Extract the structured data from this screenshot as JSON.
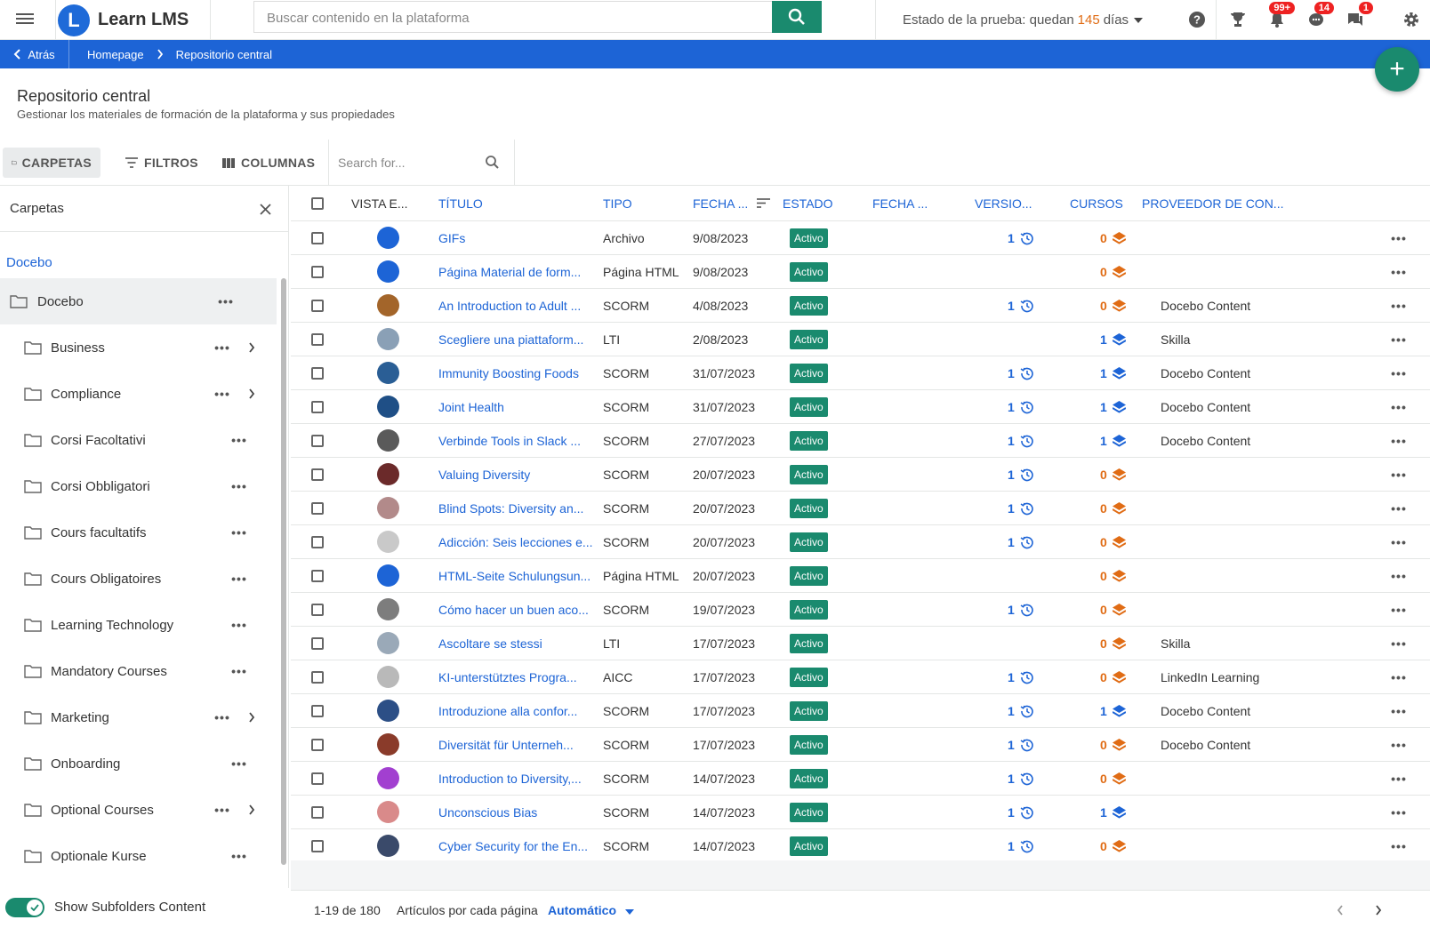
{
  "app": {
    "name": "Learn LMS",
    "logo_letter": "L"
  },
  "header": {
    "search_placeholder": "Buscar contenido en la plataforma",
    "trial_prefix": "Estado de la prueba: quedan",
    "trial_days": "145",
    "trial_suffix": "días",
    "badges": {
      "notifications": "99+",
      "messages": "14",
      "chat": "1"
    }
  },
  "breadcrumb": {
    "back": "Atrás",
    "items": [
      "Homepage",
      "Repositorio central"
    ]
  },
  "page": {
    "title": "Repositorio central",
    "subtitle": "Gestionar los materiales de formación de la plataforma y sus propiedades"
  },
  "toolbar": {
    "folders": "CARPETAS",
    "filters": "FILTROS",
    "columns": "COLUMNAS",
    "search_placeholder": "Search for..."
  },
  "sidebar": {
    "title": "Carpetas",
    "root_link": "Docebo",
    "folders": [
      {
        "label": "Docebo",
        "selected": true,
        "dots": true,
        "chevron": false
      },
      {
        "label": "Business",
        "dots": true,
        "chevron": true
      },
      {
        "label": "Compliance",
        "dots": true,
        "chevron": true
      },
      {
        "label": "Corsi Facoltativi",
        "dots": true,
        "chevron": false
      },
      {
        "label": "Corsi Obbligatori",
        "dots": true,
        "chevron": false
      },
      {
        "label": "Cours facultatifs",
        "dots": true,
        "chevron": false
      },
      {
        "label": "Cours Obligatoires",
        "dots": true,
        "chevron": false
      },
      {
        "label": "Learning Technology",
        "dots": true,
        "chevron": false
      },
      {
        "label": "Mandatory Courses",
        "dots": true,
        "chevron": false
      },
      {
        "label": "Marketing",
        "dots": true,
        "chevron": true
      },
      {
        "label": "Onboarding",
        "dots": true,
        "chevron": false
      },
      {
        "label": "Optional Courses",
        "dots": true,
        "chevron": true
      },
      {
        "label": "Optionale Kurse",
        "dots": true,
        "chevron": false
      }
    ],
    "footer_toggle_label": "Show Subfolders Content",
    "footer_toggle_on": true
  },
  "table": {
    "columns": [
      "VISTA E...",
      "TÍTULO",
      "TIPO",
      "FECHA ...",
      "ESTADO",
      "FECHA ...",
      "VERSIO...",
      "CURSOS",
      "PROVEEDOR DE CON..."
    ],
    "rows": [
      {
        "thumb": "#1d64d6",
        "title": "GIFs",
        "type": "Archivo",
        "date": "9/08/2023",
        "status": "Activo",
        "version": "1",
        "courses": "0",
        "provider": ""
      },
      {
        "thumb": "#1d64d6",
        "title": "Página Material de form...",
        "type": "Página HTML",
        "date": "9/08/2023",
        "status": "Activo",
        "version": "",
        "courses": "0",
        "provider": ""
      },
      {
        "thumb": "#a3652a",
        "title": "An Introduction to Adult ...",
        "type": "SCORM",
        "date": "4/08/2023",
        "status": "Activo",
        "version": "1",
        "courses": "0",
        "provider": "Docebo Content"
      },
      {
        "thumb": "#8aa0b6",
        "title": "Scegliere una piattaform...",
        "type": "LTI",
        "date": "2/08/2023",
        "status": "Activo",
        "version": "",
        "courses": "1",
        "provider": "Skilla"
      },
      {
        "thumb": "#2a5e95",
        "title": "Immunity Boosting Foods",
        "type": "SCORM",
        "date": "31/07/2023",
        "status": "Activo",
        "version": "1",
        "courses": "1",
        "provider": "Docebo Content"
      },
      {
        "thumb": "#1f4f86",
        "title": "Joint Health",
        "type": "SCORM",
        "date": "31/07/2023",
        "status": "Activo",
        "version": "1",
        "courses": "1",
        "provider": "Docebo Content"
      },
      {
        "thumb": "#5a5a5a",
        "title": "Verbinde Tools in Slack ...",
        "type": "SCORM",
        "date": "27/07/2023",
        "status": "Activo",
        "version": "1",
        "courses": "1",
        "provider": "Docebo Content"
      },
      {
        "thumb": "#6b2a2a",
        "title": "Valuing Diversity",
        "type": "SCORM",
        "date": "20/07/2023",
        "status": "Activo",
        "version": "1",
        "courses": "0",
        "provider": ""
      },
      {
        "thumb": "#b28a8a",
        "title": "Blind Spots: Diversity an...",
        "type": "SCORM",
        "date": "20/07/2023",
        "status": "Activo",
        "version": "1",
        "courses": "0",
        "provider": ""
      },
      {
        "thumb": "#c9c9c9",
        "title": "Adicción: Seis lecciones e...",
        "type": "SCORM",
        "date": "20/07/2023",
        "status": "Activo",
        "version": "1",
        "courses": "0",
        "provider": ""
      },
      {
        "thumb": "#1d64d6",
        "title": "HTML-Seite Schulungsun...",
        "type": "Página HTML",
        "date": "20/07/2023",
        "status": "Activo",
        "version": "",
        "courses": "0",
        "provider": ""
      },
      {
        "thumb": "#7d7d7d",
        "title": "Cómo hacer un buen aco...",
        "type": "SCORM",
        "date": "19/07/2023",
        "status": "Activo",
        "version": "1",
        "courses": "0",
        "provider": ""
      },
      {
        "thumb": "#9aa9b8",
        "title": "Ascoltare se stessi",
        "type": "LTI",
        "date": "17/07/2023",
        "status": "Activo",
        "version": "",
        "courses": "0",
        "provider": "Skilla"
      },
      {
        "thumb": "#b9b9b9",
        "title": "KI-unterstütztes Progra...",
        "type": "AICC",
        "date": "17/07/2023",
        "status": "Activo",
        "version": "1",
        "courses": "0",
        "provider": "LinkedIn Learning"
      },
      {
        "thumb": "#2c4f86",
        "title": "Introduzione alla confor...",
        "type": "SCORM",
        "date": "17/07/2023",
        "status": "Activo",
        "version": "1",
        "courses": "1",
        "provider": "Docebo Content"
      },
      {
        "thumb": "#8a3b2a",
        "title": "Diversität für Unterneh...",
        "type": "SCORM",
        "date": "17/07/2023",
        "status": "Activo",
        "version": "1",
        "courses": "0",
        "provider": "Docebo Content"
      },
      {
        "thumb": "#a23fd0",
        "title": "Introduction to Diversity,...",
        "type": "SCORM",
        "date": "14/07/2023",
        "status": "Activo",
        "version": "1",
        "courses": "0",
        "provider": ""
      },
      {
        "thumb": "#d98a8a",
        "title": "Unconscious Bias",
        "type": "SCORM",
        "date": "14/07/2023",
        "status": "Activo",
        "version": "1",
        "courses": "1",
        "provider": ""
      },
      {
        "thumb": "#3a4a6a",
        "title": "Cyber Security for the En...",
        "type": "SCORM",
        "date": "14/07/2023",
        "status": "Activo",
        "version": "1",
        "courses": "0",
        "provider": ""
      }
    ]
  },
  "pagination": {
    "range": "1-19 de 180",
    "per_page_label": "Artículos por cada página",
    "per_page_value": "Automático"
  },
  "colors": {
    "primary": "#1d64d6",
    "green": "#1a8a6e",
    "orange": "#e06c15",
    "badge": "#e22222"
  },
  "icons": [
    "menu-icon",
    "search-icon",
    "help-icon",
    "trophy-icon",
    "bell-icon",
    "chat-icon",
    "message-icon",
    "gear-icon",
    "plus-icon",
    "folder-icon",
    "filter-icon",
    "columns-icon",
    "close-icon",
    "more-icon",
    "chevron-right-icon",
    "history-icon",
    "layers-icon",
    "check-icon",
    "sort-icon"
  ]
}
